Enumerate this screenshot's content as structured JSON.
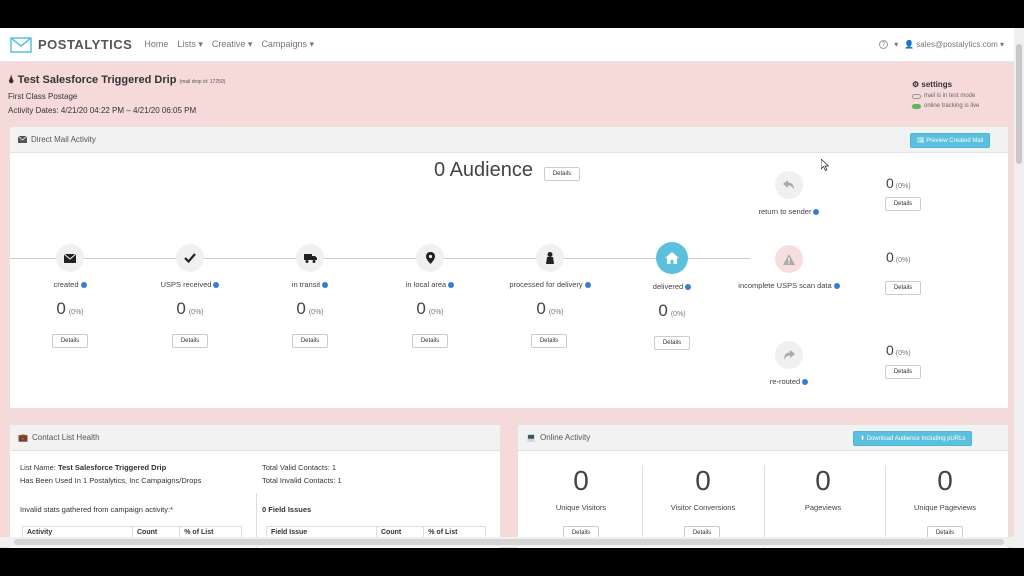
{
  "nav": {
    "brand": "POSTALYTICS",
    "links": [
      "Home",
      "Lists ▾",
      "Creative ▾",
      "Campaigns ▾"
    ],
    "help": "?",
    "user": "sales@postalytics.com ▾"
  },
  "campaign": {
    "title": "Test Salesforce Triggered Drip",
    "drop_id": "(mail drop id: 17250)",
    "postage": "First Class Postage",
    "dates": "Activity Dates: 4/21/20 04:22 PM – 4/21/20 06:05 PM"
  },
  "settings": {
    "label": "settings",
    "test_mode": "mail is in test mode",
    "tracking": "online tracking is live"
  },
  "direct_mail": {
    "title": "Direct Mail Activity",
    "preview_button": "Preview Created Mail",
    "audience": "0 Audience",
    "details_label": "Details",
    "stages": [
      {
        "label": "created",
        "count": "0",
        "pct": "(0%)",
        "icon": "envelope-icon"
      },
      {
        "label": "USPS received",
        "count": "0",
        "pct": "(0%)",
        "icon": "check-icon"
      },
      {
        "label": "in transit",
        "count": "0",
        "pct": "(0%)",
        "icon": "truck-icon"
      },
      {
        "label": "in local area",
        "count": "0",
        "pct": "(0%)",
        "icon": "map-marker-icon"
      },
      {
        "label": "processed for delivery",
        "count": "0",
        "pct": "(0%)",
        "icon": "person-icon"
      },
      {
        "label": "delivered",
        "count": "0",
        "pct": "(0%)",
        "icon": "home-icon"
      }
    ],
    "side": [
      {
        "label": "return to sender",
        "count": "0",
        "pct": "(0%)",
        "icon": "return-icon"
      },
      {
        "label": "incomplete USPS scan data",
        "count": "0",
        "pct": "(0%)",
        "icon": "warning-icon"
      },
      {
        "label": "re-routed",
        "count": "0",
        "pct": "(0%)",
        "icon": "reroute-icon"
      }
    ]
  },
  "contact_health": {
    "title": "Contact List Health",
    "list_name_label": "List Name:",
    "list_name": "Test Salesforce Triggered Drip",
    "used_in": "Has Been Used In 1 Postalytics, Inc Campaigns/Drops",
    "valid": "Total Valid Contacts: 1",
    "invalid": "Total Invalid Contacts: 1",
    "stats_note": "Invalid stats gathered from campaign activity:*",
    "field_issues": "0 Field Issues",
    "table1": [
      "Activity",
      "Count",
      "% of List"
    ],
    "table2": [
      "Field Issue",
      "Count",
      "% of List"
    ]
  },
  "online": {
    "title": "Online Activity",
    "download_button": "Download Audience Including pURLs",
    "details_label": "Details",
    "stats": [
      {
        "num": "0",
        "label": "Unique Visitors"
      },
      {
        "num": "0",
        "label": "Visitor Conversions"
      },
      {
        "num": "0",
        "label": "Pageviews"
      },
      {
        "num": "0",
        "label": "Unique Pageviews"
      }
    ]
  }
}
